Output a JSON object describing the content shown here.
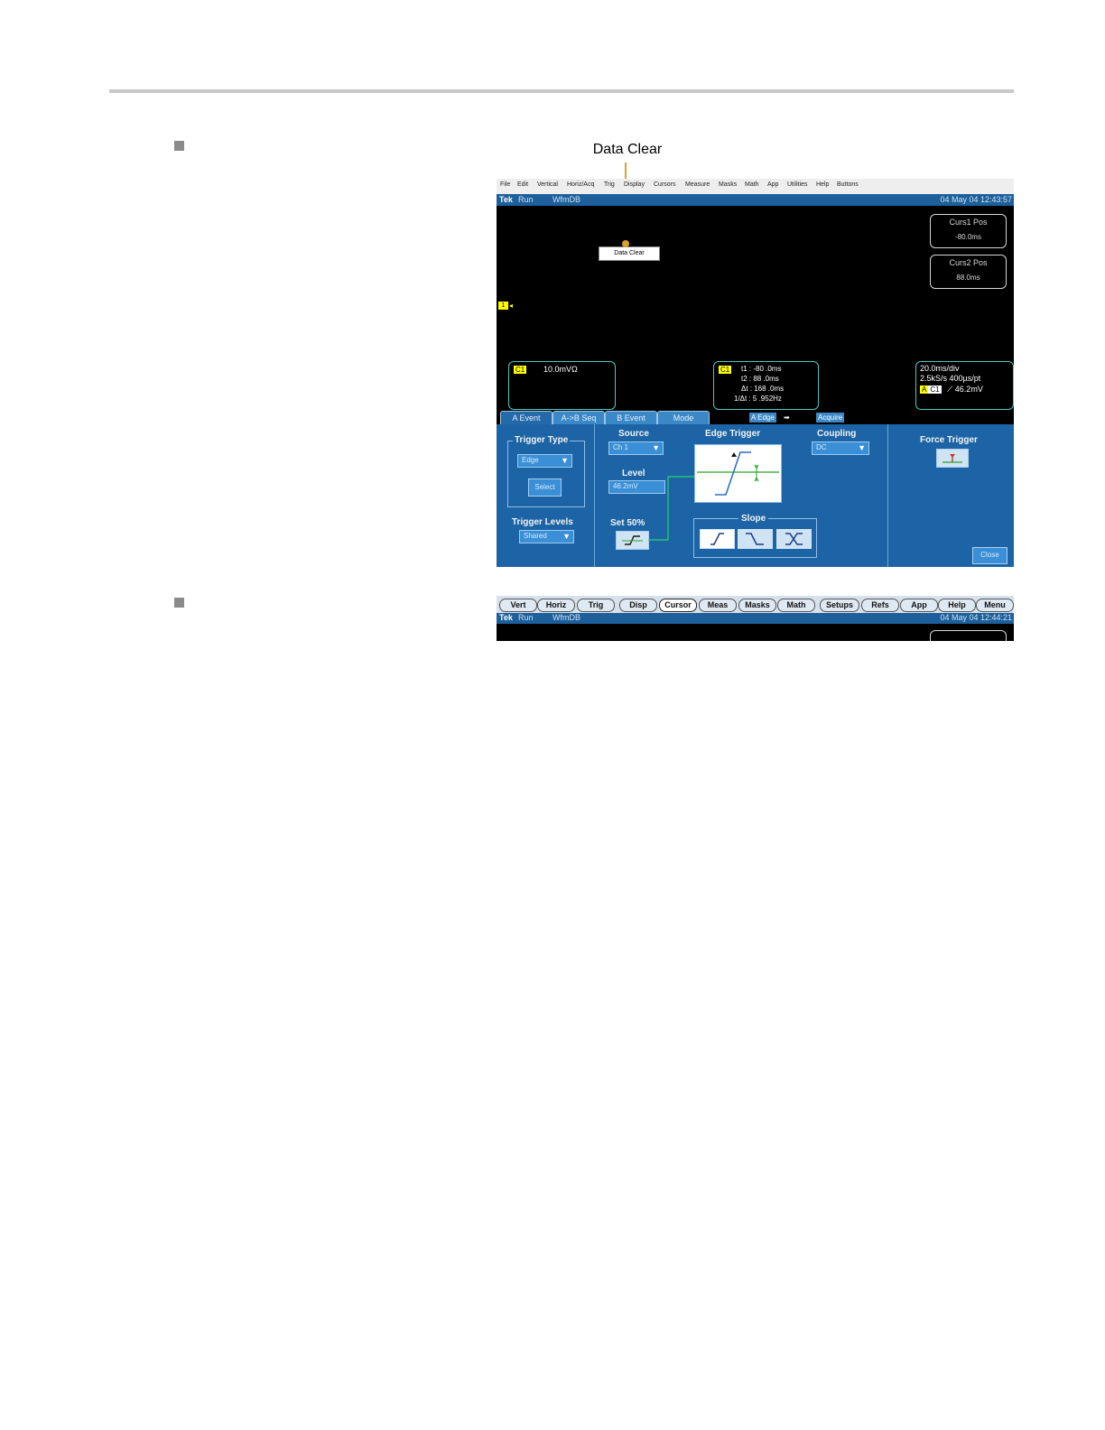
{
  "callout": {
    "label": "Data Clear"
  },
  "screen1": {
    "menu": [
      "File",
      "Edit",
      "Vertical",
      "Horiz/Acq",
      "Trig",
      "Display",
      "Cursors",
      "Measure",
      "Masks",
      "Math",
      "App",
      "Utilities",
      "Help",
      "Buttons"
    ],
    "status": {
      "brand": "Tek",
      "state": "Run",
      "mode": "WfmDB",
      "datetime": "04 May 04 12:43:57"
    },
    "readouts": [
      {
        "title": "Curs1 Pos",
        "value": "-80.0ms"
      },
      {
        "title": "Curs2 Pos",
        "value": "88.0ms"
      }
    ],
    "data_clear_button": "Data Clear",
    "channel_marker": "1",
    "channel_box": {
      "tag": "C1",
      "value": "10.0mVΩ"
    },
    "cursor_box": {
      "tag": "C1",
      "rows": [
        "t1 :  -80 .0ms",
        "t2 :   88 .0ms",
        "Δt :  168 .0ms",
        "1/Δt :    5 .952Hz"
      ]
    },
    "horiz_box": {
      "line1": "20.0ms/div",
      "line2": "2.5kS/s    400µs/pt",
      "tag_a": "A",
      "tag_c": "C1",
      "trigger": "⟋ 46.2mV"
    },
    "tabs": [
      "A Event",
      "A->B Seq",
      "B Event",
      "Mode"
    ],
    "tab_tags": [
      "A Edge",
      "➡",
      "Acquire"
    ],
    "panel": {
      "trigger_type": {
        "label": "Trigger Type",
        "value": "Edge",
        "button": "Select"
      },
      "trigger_levels": {
        "label": "Trigger Levels",
        "value": "Shared"
      },
      "source": {
        "label": "Source",
        "value": "Ch 1"
      },
      "level": {
        "label": "Level",
        "value": "46.2mV"
      },
      "set50": {
        "label": "Set 50%"
      },
      "edge_trigger": {
        "label": "Edge Trigger"
      },
      "coupling": {
        "label": "Coupling",
        "value": "DC"
      },
      "slope": {
        "label": "Slope"
      },
      "force_trigger": {
        "label": "Force Trigger"
      },
      "close": "Close"
    },
    "colors": {
      "statusbar": "#1d5f9a",
      "panel": "#1c64a5",
      "channel": "#ffff00",
      "callout": "#d9a12c"
    }
  },
  "screen2": {
    "buttons": [
      "Vert",
      "Horiz",
      "Trig",
      "Disp",
      "Cursor",
      "Meas",
      "Masks",
      "Math",
      "Setups",
      "Refs",
      "App",
      "Help",
      "Menu"
    ],
    "selected": "Cursor",
    "status": {
      "brand": "Tek",
      "state": "Run",
      "mode": "WfmDB",
      "datetime": "04 May 04 12:44:21"
    }
  }
}
